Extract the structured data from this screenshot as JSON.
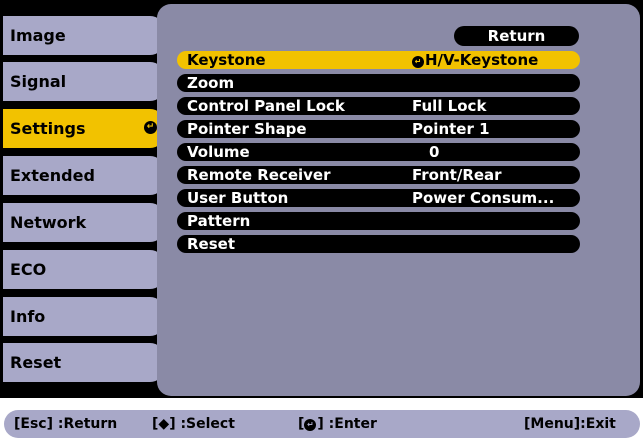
{
  "tabs": [
    {
      "label": "Image"
    },
    {
      "label": "Signal"
    },
    {
      "label": "Settings"
    },
    {
      "label": "Extended"
    },
    {
      "label": "Network"
    },
    {
      "label": "ECO"
    },
    {
      "label": "Info"
    },
    {
      "label": "Reset"
    }
  ],
  "active_tab": "Settings",
  "return_label": "Return",
  "rows": [
    {
      "label": "Keystone",
      "value": "H/V-Keystone"
    },
    {
      "label": "Zoom",
      "value": ""
    },
    {
      "label": "Control Panel Lock",
      "value": "Full Lock"
    },
    {
      "label": "Pointer Shape",
      "value": "Pointer 1"
    },
    {
      "label": "Volume",
      "value": "0"
    },
    {
      "label": "Remote Receiver",
      "value": "Front/Rear"
    },
    {
      "label": "User Button",
      "value": "Power Consum..."
    },
    {
      "label": "Pattern",
      "value": ""
    },
    {
      "label": "Reset",
      "value": ""
    }
  ],
  "selected_row": "Keystone",
  "help": {
    "esc": "[Esc] :Return",
    "select_prefix": "[",
    "select_glyph": "◆",
    "select_suffix": "] :Select",
    "enter_prefix": "[",
    "enter_suffix": "] :Enter",
    "menu": "[Menu]:Exit"
  },
  "colors": {
    "tab_bg": "#a8a8c8",
    "active": "#f2c200",
    "panel": "#8a8aa6",
    "row_bg": "#000000"
  },
  "icons": {
    "enter": "enter-icon",
    "updown": "up-down-arrow-icon"
  }
}
